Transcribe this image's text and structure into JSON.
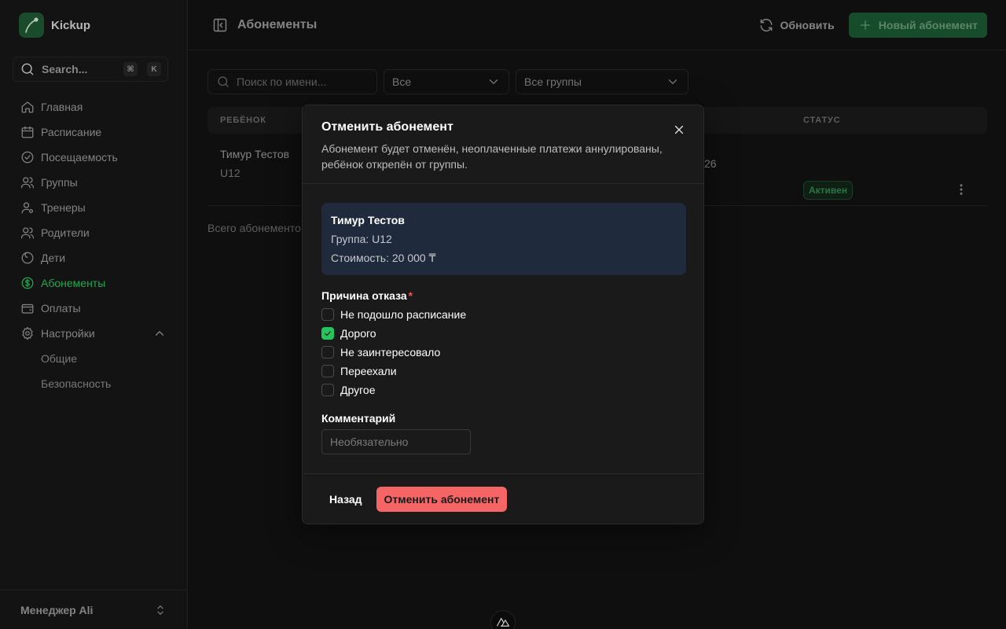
{
  "app": {
    "name": "Kickup"
  },
  "search": {
    "label": "Search...",
    "kbd1": "⌘",
    "kbd2": "K"
  },
  "nav": {
    "items": [
      {
        "label": "Главная",
        "icon": "home-icon"
      },
      {
        "label": "Расписание",
        "icon": "calendar-icon"
      },
      {
        "label": "Посещаемость",
        "icon": "check-circle-icon"
      },
      {
        "label": "Группы",
        "icon": "users-icon"
      },
      {
        "label": "Тренеры",
        "icon": "user-cog-icon"
      },
      {
        "label": "Родители",
        "icon": "users-icon"
      },
      {
        "label": "Дети",
        "icon": "child-icon"
      },
      {
        "label": "Абонементы",
        "icon": "dollar-icon",
        "active": true
      },
      {
        "label": "Оплаты",
        "icon": "wallet-icon"
      },
      {
        "label": "Настройки",
        "icon": "gear-icon",
        "expanded": true
      }
    ],
    "sub": [
      "Общие",
      "Безопасность"
    ]
  },
  "user": {
    "name": "Менеджер Ali"
  },
  "header": {
    "title": "Абонементы",
    "refresh": "Обновить",
    "new": "Новый абонемент"
  },
  "filters": {
    "search_placeholder": "Поиск по имени...",
    "status": "Все",
    "group": "Все группы"
  },
  "table": {
    "col_child": "РЕБЁНОК",
    "col_status": "СТАТУС",
    "row": {
      "name": "Тимур Тестов",
      "group": "U12",
      "date_fragment": "26",
      "status": "Активен"
    },
    "total": "Всего абонементо"
  },
  "modal": {
    "title": "Отменить абонемент",
    "description": "Абонемент будет отменён, неоплаченные платежи аннулированы, ребёнок открепён от группы.",
    "card": {
      "name": "Тимур Тестов",
      "group": "Группа: U12",
      "price": "Стоимость: 20 000 ₸"
    },
    "reason_label": "Причина отказа",
    "reasons": [
      {
        "label": "Не подошло расписание",
        "checked": false
      },
      {
        "label": "Дорого",
        "checked": true
      },
      {
        "label": "Не заинтересовало",
        "checked": false
      },
      {
        "label": "Переехали",
        "checked": false
      },
      {
        "label": "Другое",
        "checked": false
      }
    ],
    "comment_label": "Комментарий",
    "comment_placeholder": "Необязательно",
    "back": "Назад",
    "confirm": "Отменить абонемент"
  },
  "colors": {
    "accent": "#22c55e",
    "danger": "#f56565",
    "card": "#1f2b3d"
  }
}
